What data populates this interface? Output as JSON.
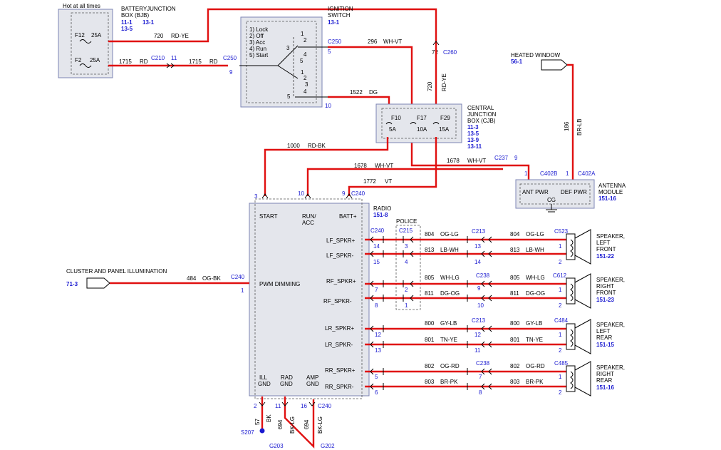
{
  "bjb": {
    "hot": "Hot at all times",
    "title1": "BATTERYJUNCTION",
    "title2": "BOX (BJB)",
    "ref1": "11-1",
    "ref2": "13-1",
    "ref3": "13-5",
    "f1_name": "F12",
    "f1_amp": "25A",
    "f2_name": "F2",
    "f2_amp": "25A"
  },
  "wires": {
    "w720": "720",
    "w720c": "RD-YE",
    "w1715a": "1715",
    "w1715ac": "RD",
    "w1715b": "1715",
    "w1715bc": "RD",
    "w296": "296",
    "w296c": "WH-VT",
    "w1522": "1522",
    "w1522c": "DG",
    "w1000": "1000",
    "w1000c": "RD-BK",
    "w1678a": "1678",
    "w1678ac": "WH-VT",
    "w1678b": "1678",
    "w1678bc": "WH-VT",
    "w1772": "1772",
    "w1772c": "VT",
    "w186": "186",
    "w186c": "BR-LB",
    "w720v": "720",
    "w720vc": "RD-YE",
    "w484": "484",
    "w484c": "OG-BK",
    "w804a": "804",
    "w804ac": "OG-LG",
    "w804b": "804",
    "w804bc": "OG-LG",
    "w813a": "813",
    "w813ac": "LB-WH",
    "w813b": "813",
    "w813bc": "LB-WH",
    "w805a": "805",
    "w805ac": "WH-LG",
    "w805b": "805",
    "w805bc": "WH-LG",
    "w811a": "811",
    "w811ac": "DG-OG",
    "w811b": "811",
    "w811bc": "DG-OG",
    "w800a": "800",
    "w800ac": "GY-LB",
    "w800b": "800",
    "w800bc": "GY-LB",
    "w801a": "801",
    "w801ac": "TN-YE",
    "w801b": "801",
    "w801bc": "TN-YE",
    "w802a": "802",
    "w802ac": "OG-RD",
    "w802b": "802",
    "w802bc": "OG-RD",
    "w803a": "803",
    "w803ac": "BR-PK",
    "w803b": "803",
    "w803bc": "BR-PK",
    "w57": "57",
    "w57c": "BK",
    "w694a": "694",
    "w694ac": "BK-LG",
    "w694b": "694",
    "w694bc": "BK-LG"
  },
  "connectors": {
    "c210": "C210",
    "c210p": "11",
    "c250a": "C250",
    "c250ap": "9",
    "c250b": "C250",
    "c250bp": "5",
    "c250cp": "10",
    "c260": "C260",
    "c260p": "72",
    "c237": "C237",
    "c237p": "9",
    "c402b": "C402B",
    "c402bp": "1",
    "c402a": "C402A",
    "c402ap": "1",
    "c240a": "C240",
    "c240ap": "9",
    "c240bp3": "3",
    "c240bp10": "10",
    "c240c": "C240",
    "c240cp": "1",
    "c240d": "C240",
    "c215": "C215",
    "c213a": "C213",
    "c213b": "C213",
    "c238a": "C238",
    "c238b": "C238",
    "c523": "C523",
    "c612": "C612",
    "c484": "C484",
    "c485": "C485",
    "c240e": "C240",
    "s207": "S207",
    "g203": "G203",
    "g202": "G202"
  },
  "pins": {
    "p14a": "14",
    "p15a": "15",
    "p3a": "3",
    "p4a": "4",
    "p13a": "13",
    "p14b": "14",
    "p1c": "1",
    "p2c": "2",
    "p7a": "7",
    "p8a": "8",
    "p2a": "2",
    "p1a": "1",
    "p9a": "9",
    "p10a": "10",
    "p1b": "1",
    "p2b": "2",
    "p12a": "12",
    "p13b": "13",
    "p12b": "12",
    "p11b": "11",
    "p1d": "1",
    "p2d": "2",
    "p5a": "5",
    "p6a": "6",
    "p7b": "7",
    "p8b": "8",
    "p1e": "1",
    "p2e": "2",
    "p2g": "2",
    "p11g": "11",
    "p16g": "16"
  },
  "ignition": {
    "title1": "IGNITION",
    "title2": "SWITCH",
    "ref": "13-1",
    "pos1": "1) Lock",
    "pos2": "2) Off",
    "pos3": "3) Acc",
    "pos4": "4) Run",
    "pos5": "5) Start",
    "s1": "1",
    "s2": "2",
    "s3": "3",
    "s4": "4",
    "s5": "5",
    "t1": "1",
    "t2": "2",
    "t3": "3",
    "t4": "4",
    "t5": "5"
  },
  "cjb": {
    "title1": "CENTRAL",
    "title2": "JUNCTION",
    "title3": "BOX (CJB)",
    "ref1": "11-3",
    "ref2": "13-5",
    "ref3": "13-9",
    "ref4": "13-11",
    "f10": "F10",
    "f10a": "5A",
    "f17": "F17",
    "f17a": "10A",
    "f29": "F29",
    "f29a": "15A"
  },
  "heated": {
    "title": "HEATED WINDOW",
    "ref": "56-1"
  },
  "antenna": {
    "title1": "ANTENNA",
    "title2": "MODULE",
    "ref": "151-16",
    "ant": "ANT PWR",
    "def": "DEF PWR",
    "cg": "CG"
  },
  "radio": {
    "title": "RADIO",
    "ref": "151-8",
    "start": "START",
    "run1": "RUN/",
    "run2": "ACC",
    "batt": "BATT+",
    "pwm": "PWM DIMMING",
    "lfp": "LF_SPKR+",
    "lfm": "LF_SPKR-",
    "rfp": "RF_SPKR+",
    "rfm": "RF_SPKR-",
    "lrp": "LR_SPKR+",
    "lrm": "LR_SPKR-",
    "rrp": "RR_SPKR+",
    "rrm": "RR_SPKR-",
    "ill1": "ILL",
    "ill2": "GND",
    "rad1": "RAD",
    "rad2": "GND",
    "amp1": "AMP",
    "amp2": "GND"
  },
  "police": "POLICE",
  "cluster": {
    "title": "CLUSTER AND PANEL ILLUMINATION",
    "ref": "71-3"
  },
  "speakers": [
    {
      "l1": "SPEAKER,",
      "l2": "LEFT",
      "l3": "FRONT",
      "ref": "151-22"
    },
    {
      "l1": "SPEAKER,",
      "l2": "RIGHT",
      "l3": "FRONT",
      "ref": "151-23"
    },
    {
      "l1": "SPEAKER,",
      "l2": "LEFT",
      "l3": "REAR",
      "ref": "151-15"
    },
    {
      "l1": "SPEAKER,",
      "l2": "RIGHT",
      "l3": "REAR",
      "ref": "151-16"
    }
  ],
  "colors": {
    "wire": "#e01010",
    "ref": "#1a1ad0",
    "box": "#e4e6ec"
  }
}
